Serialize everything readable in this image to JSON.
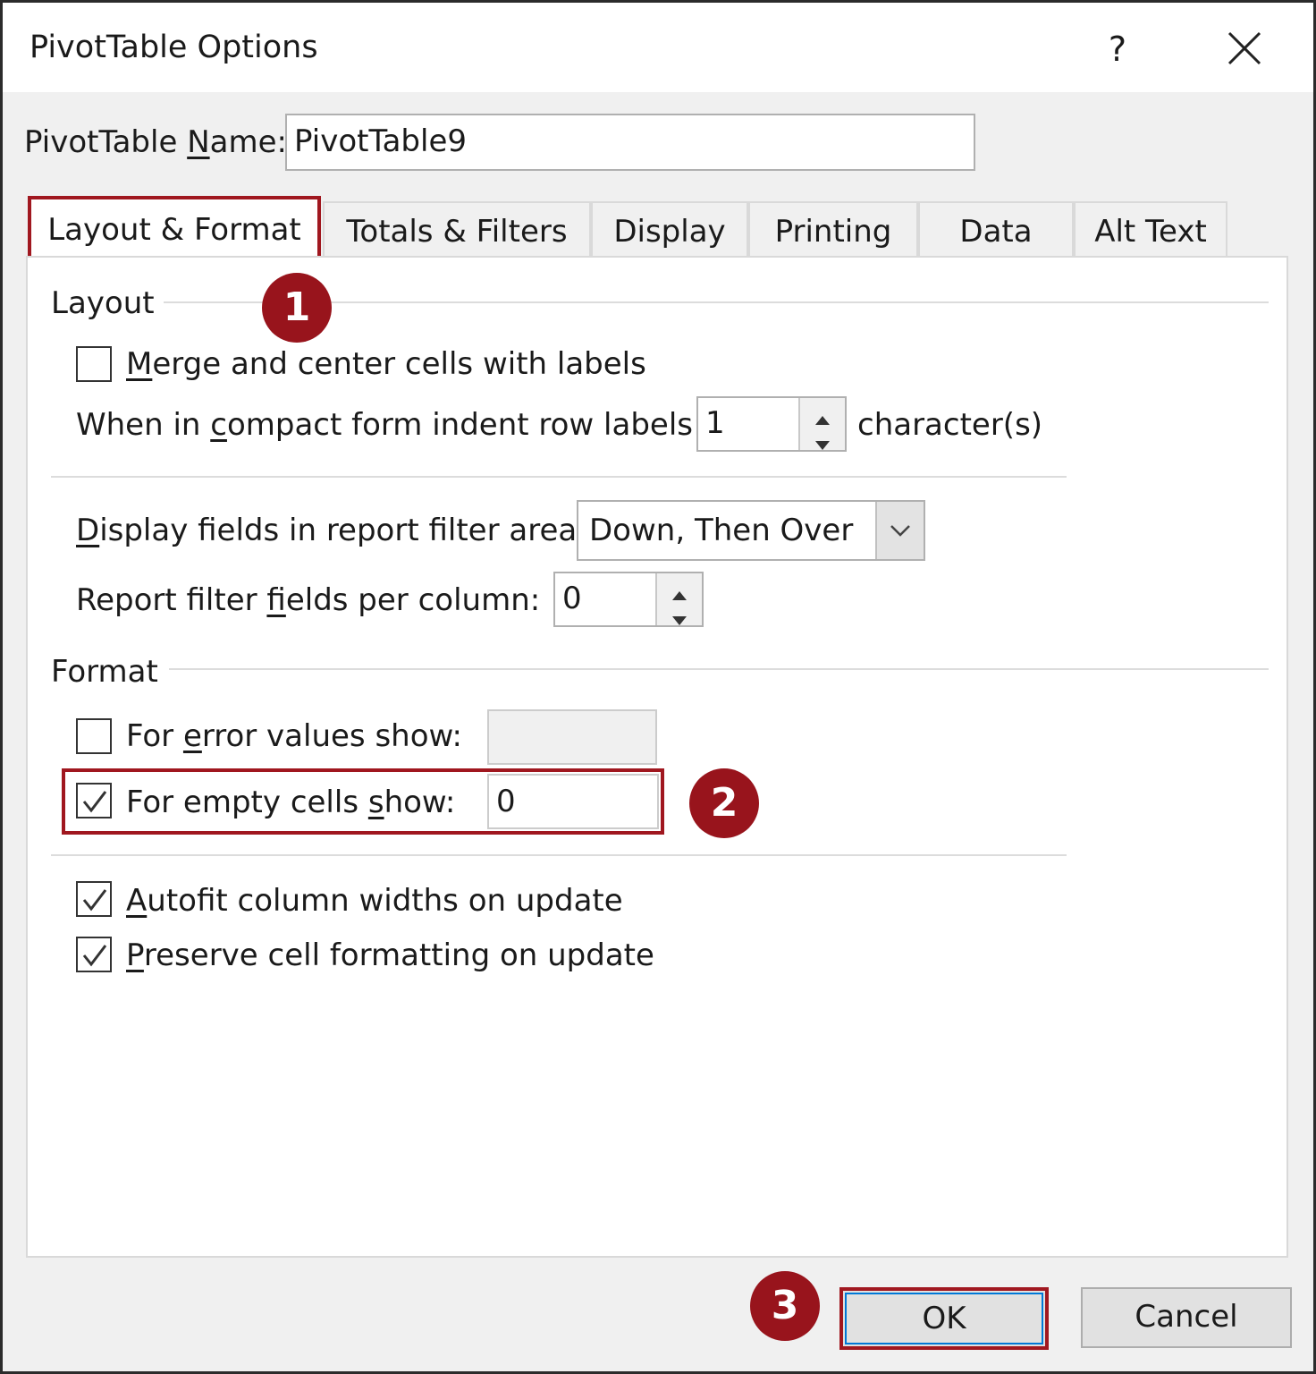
{
  "window": {
    "title": "PivotTable Options",
    "help_label": "?"
  },
  "name_field": {
    "label_pre": "PivotTable ",
    "label_key": "N",
    "label_post": "ame:",
    "value": "PivotTable9"
  },
  "tabs": [
    {
      "label": "Layout & Format",
      "active": true
    },
    {
      "label": "Totals & Filters",
      "active": false
    },
    {
      "label": "Display",
      "active": false
    },
    {
      "label": "Printing",
      "active": false
    },
    {
      "label": "Data",
      "active": false
    },
    {
      "label": "Alt Text",
      "active": false
    }
  ],
  "layout_section": {
    "heading": "Layout",
    "merge_center": {
      "pre": "",
      "key": "M",
      "post": "erge and center cells with labels",
      "checked": false
    },
    "indent": {
      "pre": "When in ",
      "key": "c",
      "post": "ompact form indent row labels:",
      "value": "1",
      "suffix": "character(s)"
    },
    "display_fields": {
      "pre": "",
      "key": "D",
      "post": "isplay fields in report filter area:",
      "value": "Down, Then Over"
    },
    "filter_fields": {
      "pre": "Report filter ",
      "key": "f",
      "post": "ields per column:",
      "value": "0"
    }
  },
  "format_section": {
    "heading": "Format",
    "error_values": {
      "pre": "For ",
      "key": "e",
      "post": "rror values show:",
      "value": "",
      "checked": false
    },
    "empty_cells": {
      "pre": "For empty cells ",
      "key": "s",
      "post": "how:",
      "value": "0",
      "checked": true
    },
    "autofit": {
      "pre": "",
      "key": "A",
      "post": "utofit column widths on update",
      "checked": true
    },
    "preserve": {
      "pre": "",
      "key": "P",
      "post": "reserve cell formatting on update",
      "checked": true
    }
  },
  "callouts": [
    "1",
    "2",
    "3"
  ],
  "buttons": {
    "ok": "OK",
    "cancel": "Cancel"
  },
  "colors": {
    "highlight": "#a0171f",
    "badge": "#98141c",
    "focus": "#0078d7"
  }
}
